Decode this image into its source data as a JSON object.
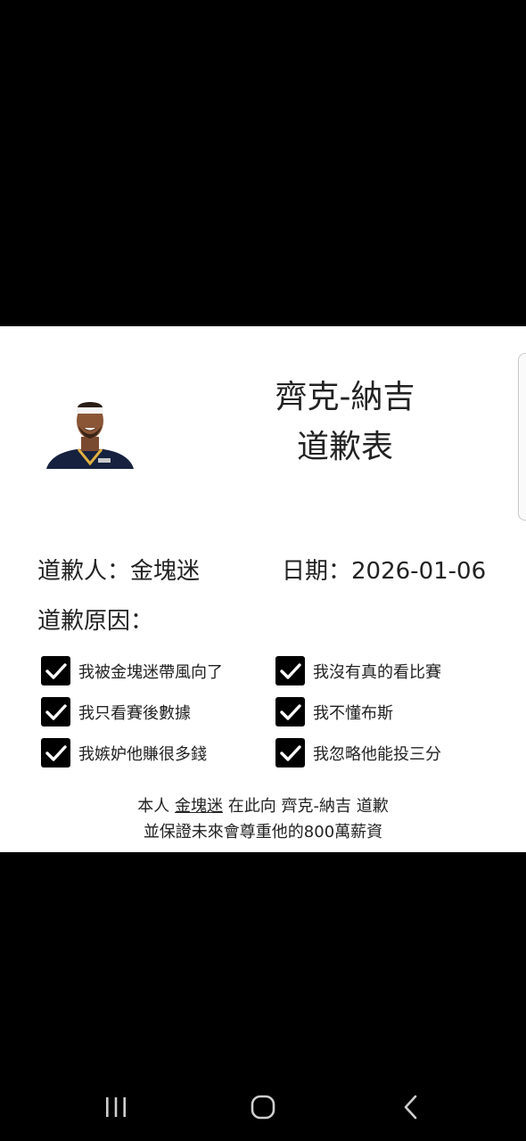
{
  "form": {
    "title_line1": "齊克-納吉",
    "title_line2": "道歉表",
    "apologizer_label": "道歉人：",
    "apologizer_name": "金塊迷",
    "date_label": "日期：",
    "date_value": "2026-01-06",
    "reason_label": "道歉原因：",
    "reasons": [
      {
        "label": "我被金塊迷帶風向了",
        "checked": true
      },
      {
        "label": "我沒有真的看比賽",
        "checked": true
      },
      {
        "label": "我只看賽後數據",
        "checked": true
      },
      {
        "label": "我不懂布斯",
        "checked": true
      },
      {
        "label": "我嫉妒他賺很多錢",
        "checked": true
      },
      {
        "label": "我忽略他能投三分",
        "checked": true
      }
    ],
    "statement": {
      "prefix": "本人",
      "name": "金塊迷",
      "middle": "在此向",
      "target": "齊克-納吉",
      "suffix": "道歉",
      "line2": "並保證未來會尊重他的800萬薪資"
    }
  },
  "colors": {
    "background": "#000000",
    "card": "#ffffff",
    "checkbox": "#000000",
    "text": "#222222"
  },
  "navbar": {
    "buttons": [
      "recent-apps-icon",
      "home-icon",
      "back-icon"
    ]
  }
}
